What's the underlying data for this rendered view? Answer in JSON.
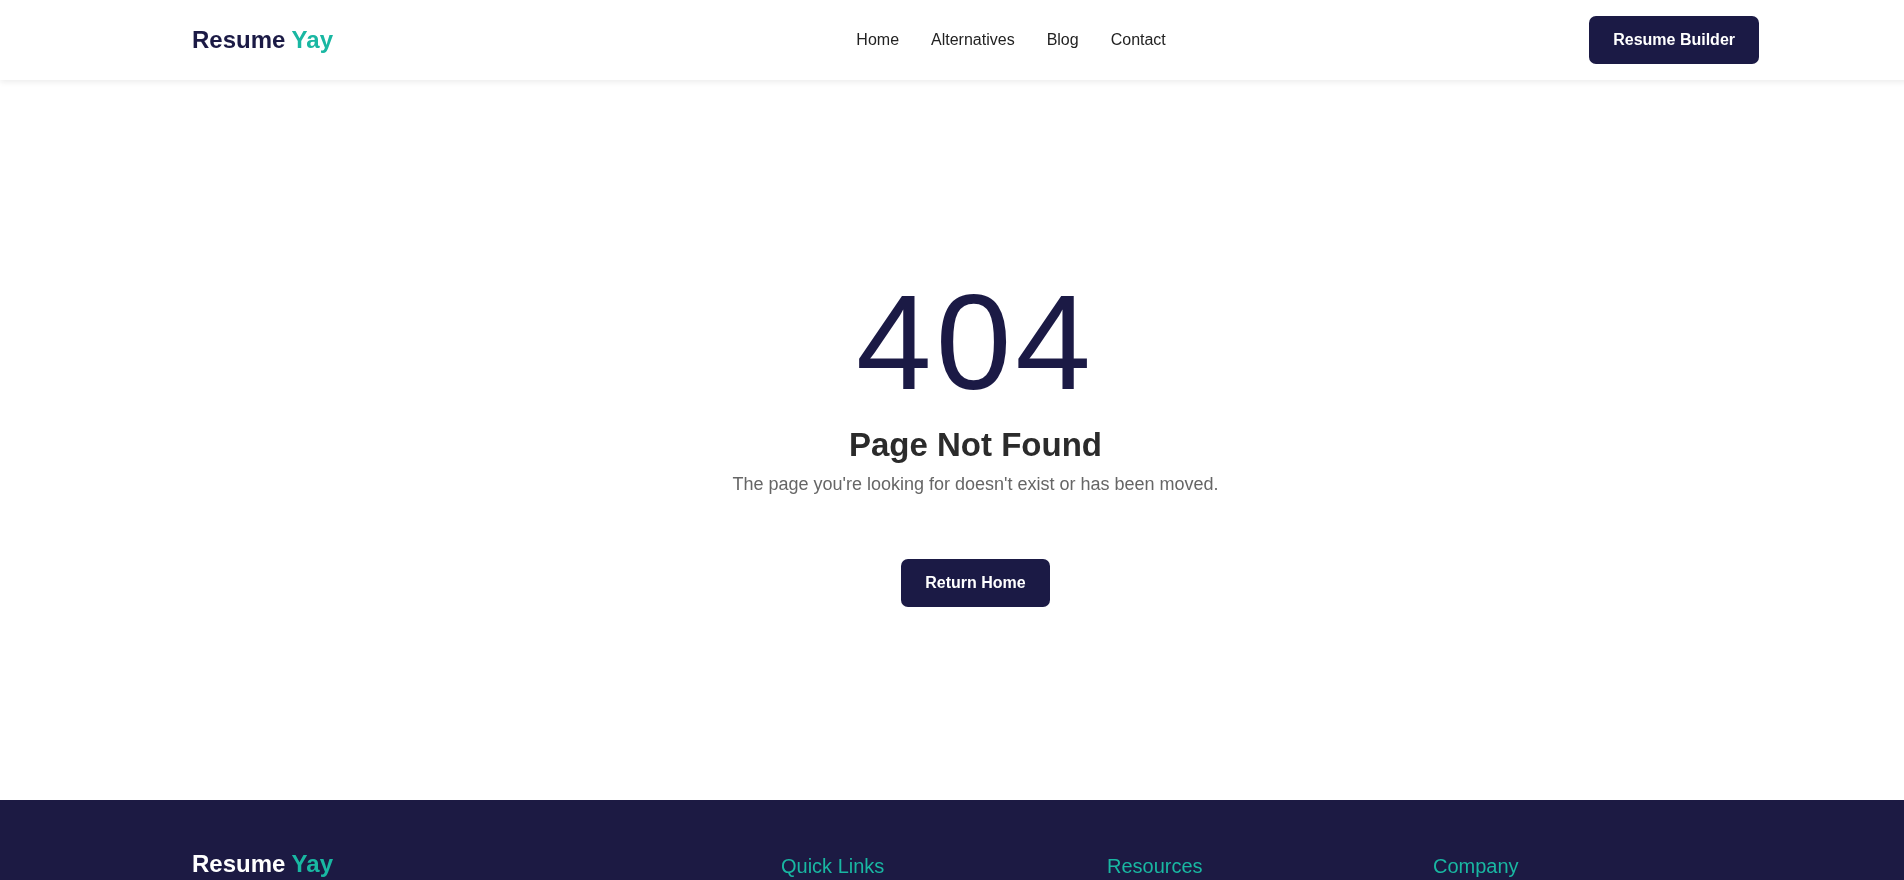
{
  "header": {
    "logo": {
      "text": "Resume",
      "accent": "Yay"
    },
    "nav": [
      "Home",
      "Alternatives",
      "Blog",
      "Contact"
    ],
    "cta": "Resume Builder"
  },
  "error": {
    "code": "404",
    "title": "Page Not Found",
    "message": "The page you're looking for doesn't exist or has been moved.",
    "button": "Return Home"
  },
  "footer": {
    "logo": {
      "text": "Resume",
      "accent": "Yay"
    },
    "columns": [
      "Quick Links",
      "Resources",
      "Company"
    ]
  }
}
